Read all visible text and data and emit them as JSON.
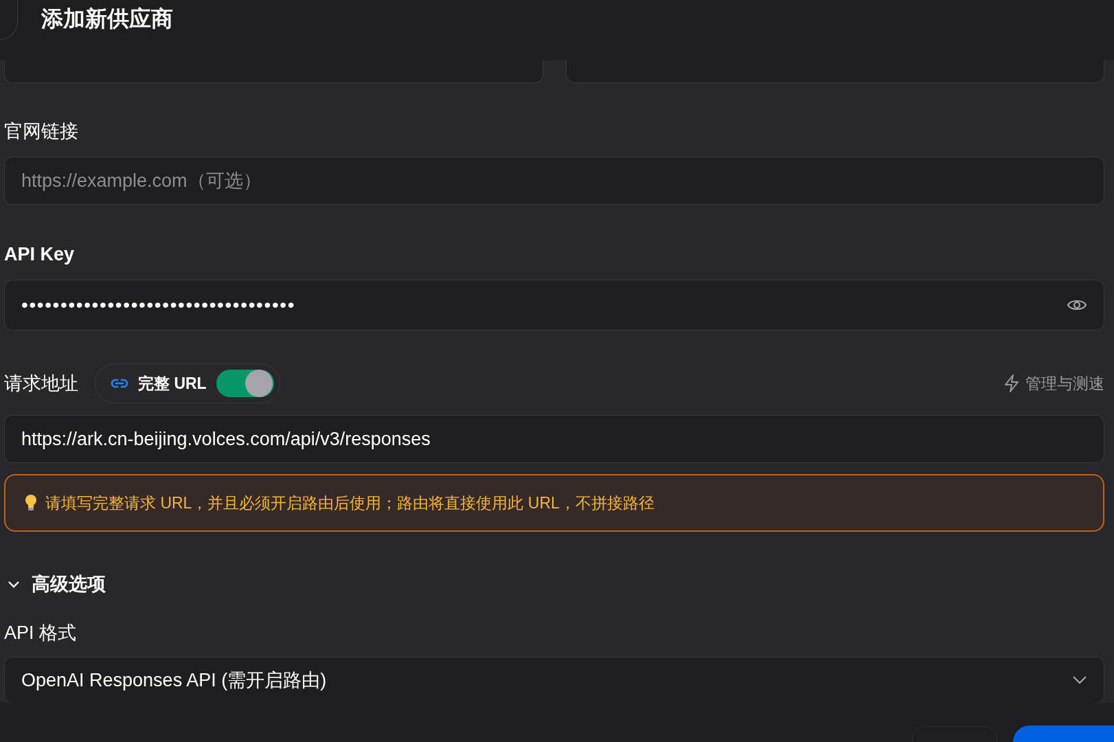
{
  "header": {
    "title": "添加新供应商"
  },
  "website": {
    "label": "官网链接",
    "placeholder": "https://example.com（可选）"
  },
  "api_key": {
    "label": "API Key",
    "value": "•••••••••••••••••••••••••••••••••••"
  },
  "endpoint": {
    "label": "请求地址",
    "full_url_toggle": {
      "label": "完整 URL",
      "on": true
    },
    "manage_link": "管理与测速",
    "value": "https://ark.cn-beijing.volces.com/api/v3/responses",
    "hint": "请填写完整请求 URL，并且必须开启路由后使用；路由将直接使用此 URL，不拼接路径"
  },
  "advanced": {
    "label": "高级选项",
    "expanded": true
  },
  "api_format": {
    "label": "API 格式",
    "value": "OpenAI Responses API (需开启路由)"
  }
}
